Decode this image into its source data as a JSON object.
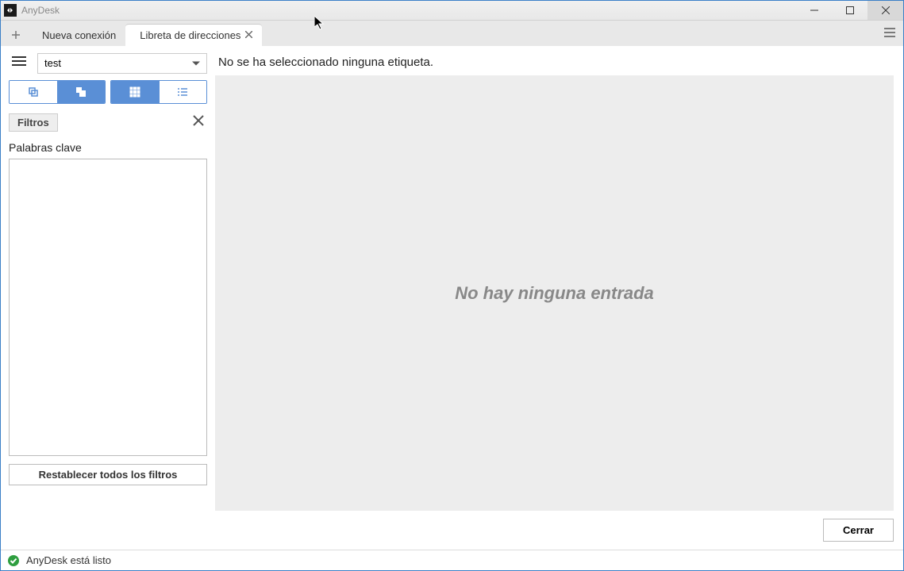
{
  "window": {
    "title": "AnyDesk"
  },
  "tabs": {
    "new_connection": "Nueva conexión",
    "address_book": "Libreta de direcciones"
  },
  "sidebar": {
    "dropdown_value": "test",
    "filters_label": "Filtros",
    "keywords_label": "Palabras clave",
    "reset_button": "Restablecer todos los filtros"
  },
  "content": {
    "header": "No se ha seleccionado ninguna etiqueta.",
    "empty_message": "No hay ninguna entrada",
    "close_button": "Cerrar"
  },
  "status": {
    "text": "AnyDesk está listo"
  }
}
